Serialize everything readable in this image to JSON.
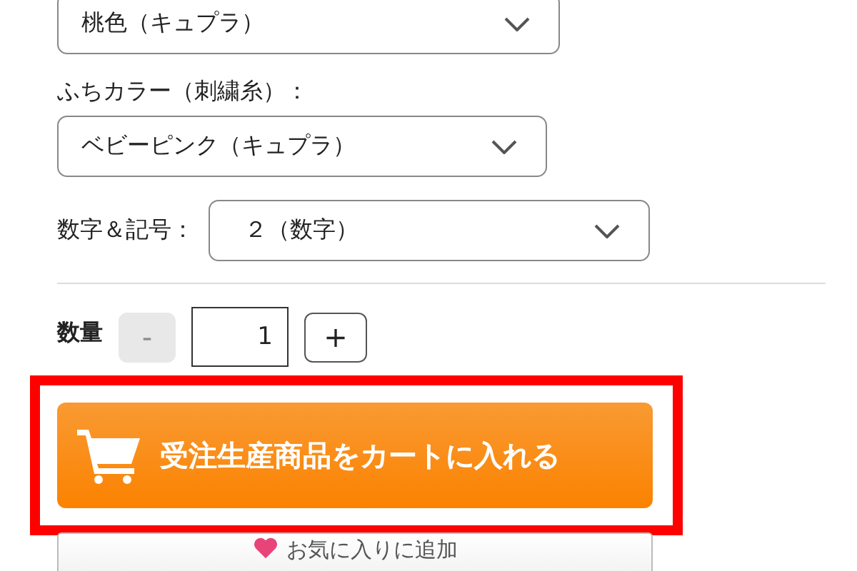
{
  "selects": [
    {
      "value": "桃色（キュプラ）"
    },
    {
      "label": "ふちカラー（刺繍糸）：",
      "value": "ベビーピンク（キュプラ）"
    },
    {
      "label": "数字＆記号：",
      "value": "２（数字）",
      "inline": true
    }
  ],
  "quantity": {
    "label": "数量",
    "minus": {
      "text": "-",
      "disabled": true
    },
    "value": "1",
    "plus": {
      "text": "+",
      "disabled": false
    }
  },
  "cart_button": {
    "text": "受注生産商品をカートに入れる",
    "highlighted": true
  },
  "favorite_button": {
    "text": "お気に入りに追加"
  }
}
